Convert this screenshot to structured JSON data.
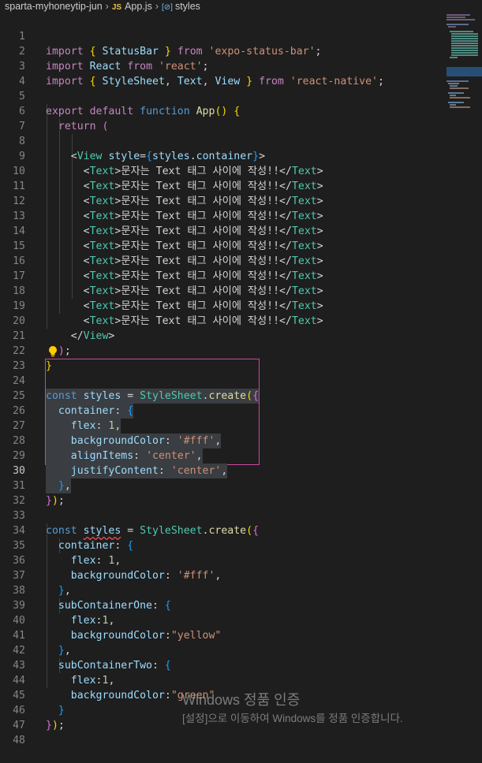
{
  "breadcrumb": {
    "folder": "sparta-myhoneytip-jun",
    "file_badge": "JS",
    "file": "App.js",
    "symbol_badge": "[⊘]",
    "symbol": "styles"
  },
  "editor": {
    "language": "javascript",
    "active_line": 30,
    "line_numbers": [
      "1",
      "2",
      "3",
      "4",
      "5",
      "6",
      "7",
      "8",
      "9",
      "10",
      "11",
      "12",
      "13",
      "14",
      "15",
      "16",
      "17",
      "18",
      "19",
      "20",
      "21",
      "22",
      "23",
      "24",
      "25",
      "26",
      "27",
      "28",
      "29",
      "30",
      "31",
      "32",
      "33",
      "34",
      "35",
      "36",
      "37",
      "38",
      "39",
      "40",
      "41",
      "42",
      "43",
      "44",
      "45",
      "46",
      "47",
      "48"
    ],
    "text": {
      "import": "import",
      "from": "from",
      "export": "export",
      "default": "default",
      "function": "function",
      "return": "return",
      "const": "const",
      "StatusBar": "StatusBar",
      "expo_status_bar": "'expo-status-bar'",
      "React": "React",
      "react": "'react'",
      "StyleSheet": "StyleSheet",
      "Text": "Text",
      "View": "View",
      "react_native": "'react-native'",
      "App": "App",
      "style": "style",
      "styles": "styles",
      "container": "container",
      "create": "create",
      "korean": "문자는 Text 태그 사이에 작성!!",
      "flex": "flex",
      "backgroundColor": "backgroundColor",
      "alignItems": "alignItems",
      "justifyContent": "justifyContent",
      "one": "1",
      "fff": "'#fff'",
      "center": "'center'",
      "subContainerOne": "subContainerOne",
      "subContainerTwo": "subContainerTwo",
      "yellow": "\"yellow\"",
      "green": "\"green\""
    }
  },
  "watermark": {
    "title": "Windows 정품 인증",
    "subtitle": "[설정]으로 이동하여 Windows를 정품 인증합니다."
  },
  "colors": {
    "background": "#1e1e1e",
    "keyword": "#c586c0",
    "storage": "#569cd6",
    "function": "#dcdcaa",
    "variable": "#9cdcfe",
    "string": "#ce9178",
    "number": "#b5cea8",
    "class": "#4ec9b0",
    "selection": "#3a3d41",
    "selection_border": "#c64a9c"
  }
}
